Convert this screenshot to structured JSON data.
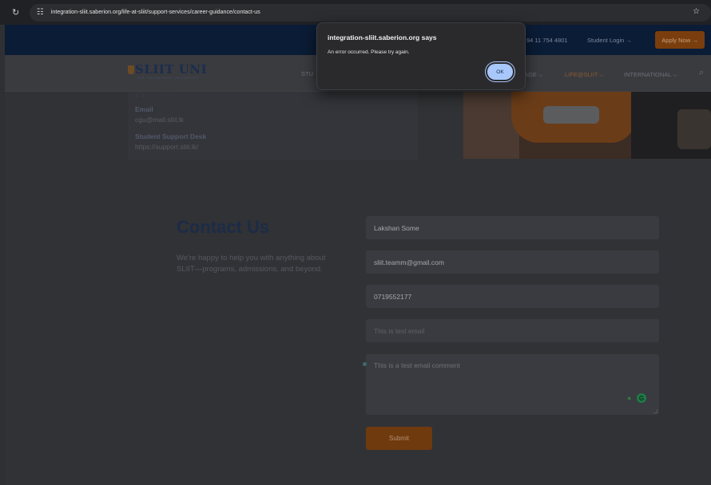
{
  "browser": {
    "url": "integration-sliit.saberion.org/life-at-sliit/support-services/career-guidance/contact-us"
  },
  "topbar": {
    "phone": "94 11 754 4801",
    "student_login": "Student Login →",
    "apply_now": "Apply Now →"
  },
  "nav": {
    "logo_text": "SLIIT UNI",
    "logo_sub": "THE KNOWLEDGE UNIVERSITY",
    "partial_item": "STU",
    "items": [
      "AGE ⌵",
      "LIFE@SLIIT ⌵",
      "INTERNATIONAL ⌵"
    ]
  },
  "info": {
    "cut_text": "· · · · · · ·",
    "email_label": "Email",
    "email_value": "cgu@mail.sliit.lk",
    "desk_label": "Student Support Desk",
    "desk_value": "https://support.sliit.lk/"
  },
  "contact": {
    "title": "Contact Us",
    "description": "We're happy to help you with anything about SLIIT—programs, admissions, and beyond."
  },
  "form": {
    "name": "Lakshan Some",
    "email": "sliit.teamm@gmail.com",
    "phone": "0719552177",
    "subject_placeholder": "This is test email",
    "comment": "This is a test email comment",
    "submit": "Submit"
  },
  "dialog": {
    "title": "integration-sliit.saberion.org says",
    "message": "An error occurred. Please try again.",
    "ok": "OK"
  }
}
